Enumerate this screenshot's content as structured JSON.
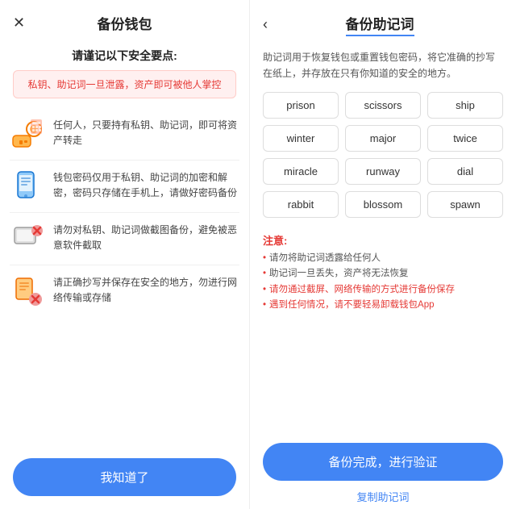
{
  "left": {
    "close_icon": "✕",
    "title": "备份钱包",
    "subtitle": "请谨记以下安全要点:",
    "warning": "私钥、助记词一旦泄露，资产即可被他人掌控",
    "items": [
      {
        "icon": "key",
        "text": "任何人，只要持有私钥、助记词，即可将资产转走"
      },
      {
        "icon": "phone",
        "text": "钱包密码仅用于私钥、助记词的加密和解密，密码只存储在手机上，请做好密码备份"
      },
      {
        "icon": "screenshot",
        "text": "请勿对私钥、助记词做截图备份，避免被恶意软件截取"
      },
      {
        "icon": "safe",
        "text": "请正确抄写并保存在安全的地方，勿进行网络传输或存储"
      }
    ],
    "button_label": "我知道了"
  },
  "right": {
    "back_icon": "‹",
    "title": "备份助记词",
    "description": "助记词用于恢复钱包或重置钱包密码，将它准确的抄写在纸上，并存放在只有你知道的安全的地方。",
    "words": [
      "prison",
      "scissors",
      "ship",
      "winter",
      "major",
      "twice",
      "miracle",
      "runway",
      "dial",
      "rabbit",
      "blossom",
      "spawn"
    ],
    "notes_title": "注意:",
    "notes": [
      {
        "text": "请勿将助记词透露给任何人",
        "red": false
      },
      {
        "text": "助记词一旦丢失，资产将无法恢复",
        "red": false
      },
      {
        "text": "请勿通过截屏、网络传输的方式进行备份保存",
        "red": true
      },
      {
        "text": "遇到任何情况，请不要轻易卸载钱包App",
        "red": true
      }
    ],
    "button_label": "备份完成，进行验证",
    "copy_label": "复制助记词"
  },
  "colors": {
    "accent": "#4285f4",
    "danger": "#e53935",
    "warning_bg": "#fff0f0"
  }
}
